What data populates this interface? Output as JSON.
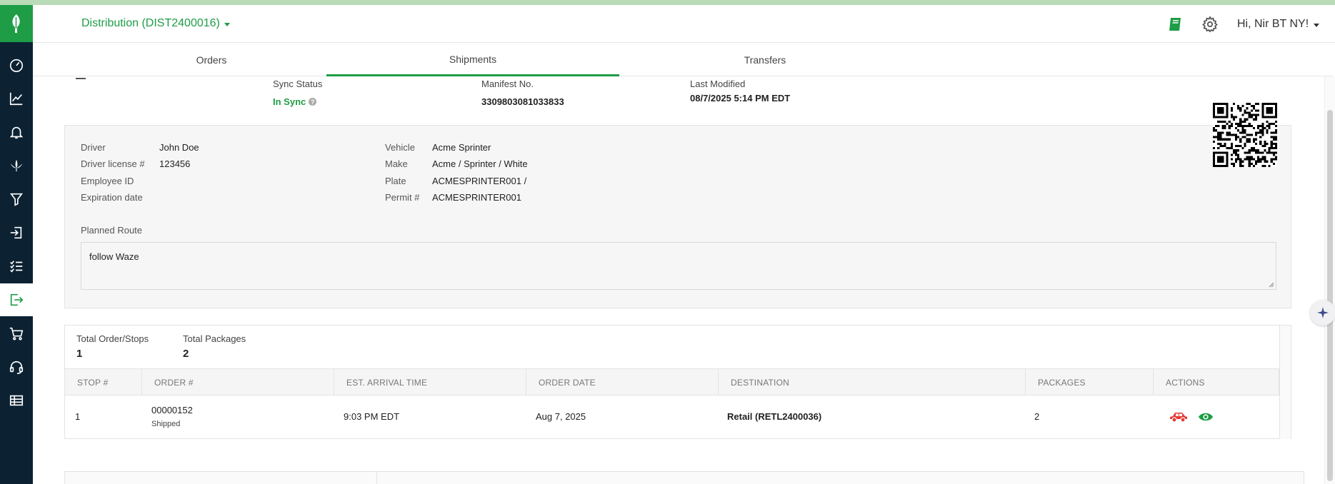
{
  "header": {
    "distribution_label": "Distribution (DIST2400016)",
    "user_greeting": "Hi, Nir BT NY!",
    "book_icon": "book-icon",
    "settings_icon": "gear-icon"
  },
  "sidebar": {
    "items": [
      {
        "icon": "dashboard-icon"
      },
      {
        "icon": "analytics-icon"
      },
      {
        "icon": "bell-icon"
      },
      {
        "icon": "cannabis-leaf-icon"
      },
      {
        "icon": "funnel-icon"
      },
      {
        "icon": "inbound-icon"
      },
      {
        "icon": "checklist-icon"
      },
      {
        "icon": "outbound-icon",
        "active": true
      },
      {
        "icon": "cart-icon"
      },
      {
        "icon": "headset-icon"
      },
      {
        "icon": "table-icon"
      }
    ]
  },
  "tabs": [
    {
      "label": "Orders",
      "active": false
    },
    {
      "label": "Shipments",
      "active": true
    },
    {
      "label": "Transfers",
      "active": false
    }
  ],
  "meta": {
    "sync_status_label": "Sync Status",
    "sync_status_value": "In Sync",
    "manifest_label": "Manifest No.",
    "manifest_value": "3309803081033833",
    "last_modified_label": "Last Modified",
    "last_modified_value": "08/7/2025 5:14 PM EDT"
  },
  "driver": {
    "driver_label": "Driver",
    "driver_value": "John Doe",
    "license_label": "Driver license #",
    "license_value": "123456",
    "employee_label": "Employee ID",
    "employee_value": "",
    "expiration_label": "Expiration date",
    "expiration_value": "",
    "vehicle_label": "Vehicle",
    "vehicle_value": "Acme Sprinter",
    "make_label": "Make",
    "make_value": "Acme / Sprinter / White",
    "plate_label": "Plate",
    "plate_value": "ACMESPRINTER001 /",
    "permit_label": "Permit #",
    "permit_value": "ACMESPRINTER001",
    "planned_route_label": "Planned Route",
    "planned_route_value": "follow Waze"
  },
  "totals": {
    "orders_label": "Total Order/Stops",
    "orders_value": "1",
    "packages_label": "Total Packages",
    "packages_value": "2"
  },
  "table": {
    "columns": [
      "STOP #",
      "ORDER #",
      "EST. ARRIVAL TIME",
      "ORDER DATE",
      "DESTINATION",
      "PACKAGES",
      "ACTIONS"
    ],
    "rows": [
      {
        "stop": "1",
        "order": "00000152",
        "order_status": "Shipped",
        "arrival": "9:03 PM EDT",
        "order_date": "Aug 7, 2025",
        "destination": "Retail (RETL2400036)",
        "packages": "2"
      }
    ]
  },
  "colors": {
    "brand_green": "#1e9d46",
    "sidebar_bg": "#0c2233",
    "action_red": "#e53935"
  }
}
